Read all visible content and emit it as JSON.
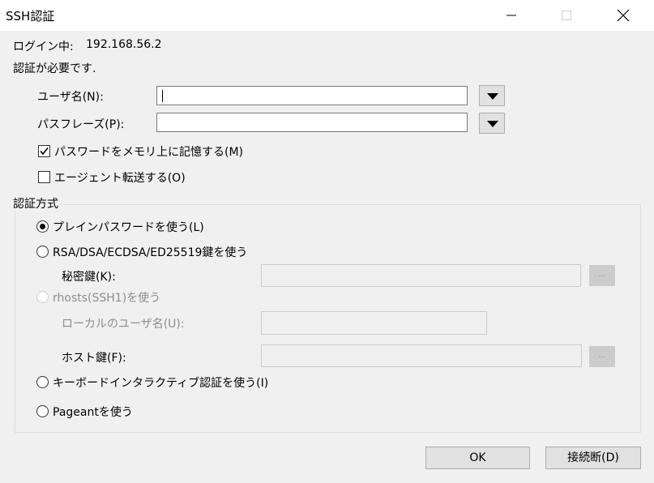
{
  "window": {
    "title": "SSH認証"
  },
  "header": {
    "login_label": "ログイン中:",
    "host": "192.168.56.2",
    "auth_required": "認証が必要です."
  },
  "fields": {
    "username_label": "ユーザ名(N):",
    "username_value": "",
    "passphrase_label": "パスフレーズ(P):",
    "passphrase_value": ""
  },
  "options": {
    "remember_password": {
      "label": "パスワードをメモリ上に記憶する(M)",
      "checked": true
    },
    "agent_forward": {
      "label": "エージェント転送する(O)",
      "checked": false
    }
  },
  "auth_method": {
    "title": "認証方式",
    "plain_password": "プレインパスワードを使う(L)",
    "rsa_key": "RSA/DSA/ECDSA/ED25519鍵を使う",
    "private_key_label": "秘密鍵(K):",
    "browse_label": "...",
    "rhosts": "rhosts(SSH1)を使う",
    "local_user_label": "ローカルのユーザ名(U):",
    "host_key_label": "ホスト鍵(F):",
    "keyboard_interactive": "キーボードインタラクティブ認証を使う(I)",
    "pageant": "Pageantを使う",
    "selected": "plain_password"
  },
  "buttons": {
    "ok": "OK",
    "disconnect": "接続断(D)"
  },
  "icons": {
    "minimize": "minimize-icon",
    "maximize": "maximize-icon",
    "close": "close-icon",
    "dropdown": "triangle-down-icon",
    "checkmark": "checkmark-icon"
  }
}
